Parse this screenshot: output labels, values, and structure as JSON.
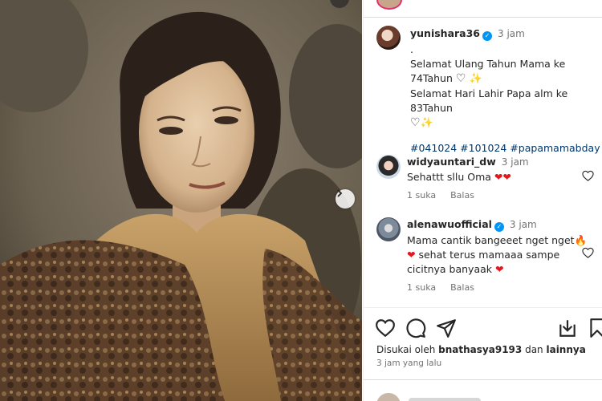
{
  "post": {
    "author": "yunishara36",
    "author_time": "3 jam",
    "caption_dot": ".",
    "caption_line1": "Selamat Ulang Tahun Mama ke",
    "caption_line2": "74Tahun",
    "caption_line3": "Selamat Hari Lahir Papa alm ke 83Tahun",
    "hashtags": "#041024 #101024 #papamamabday"
  },
  "comments": [
    {
      "username": "widyauntari_dw",
      "time": "3 jam",
      "text": "Sehattt sllu Oma",
      "likes": "1 suka",
      "reply": "Balas"
    },
    {
      "username": "alenawuofficial",
      "time": "3 jam",
      "text_line1": "Mama cantik bangeeet nget nget",
      "text_line2": "sehat terus mamaaa sampe",
      "text_line3": "cicitnya banyaak",
      "likes": "1 suka",
      "reply": "Balas"
    }
  ],
  "likes_line": {
    "prefix": "Disukai oleh",
    "user": "bnathasya9193",
    "connector": "dan",
    "rest": "lainnya"
  },
  "posted_ago": "3 jam yang lalu",
  "icons": {
    "verified": "verified-badge-icon",
    "heart": "heart-icon",
    "comment": "comment-icon",
    "share": "share-icon",
    "save": "bookmark-icon",
    "next": "chevron-right-icon"
  },
  "colors": {
    "verified_blue": "#0095f6",
    "hashtag_blue": "#00376b",
    "heart_red": "#e0191f",
    "muted_text": "#737373"
  }
}
